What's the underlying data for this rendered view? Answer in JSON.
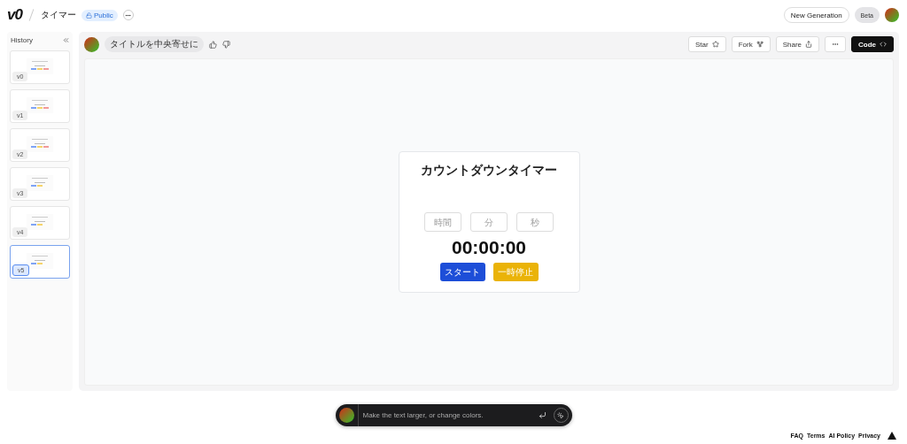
{
  "header": {
    "logo": "v0",
    "project": "タイマー",
    "visibility": "Public",
    "new_generation": "New Generation",
    "beta": "Beta"
  },
  "history": {
    "title": "History",
    "items": [
      {
        "label": "v0",
        "selected": false
      },
      {
        "label": "v1",
        "selected": false
      },
      {
        "label": "v2",
        "selected": false
      },
      {
        "label": "v3",
        "selected": false
      },
      {
        "label": "v4",
        "selected": false
      },
      {
        "label": "v5",
        "selected": true
      }
    ]
  },
  "toolbar": {
    "prompt_chip": "タイトルを中央寄せに",
    "buttons": [
      {
        "label": "Star",
        "kind": "star"
      },
      {
        "label": "Fork",
        "kind": "fork"
      },
      {
        "label": "Share",
        "kind": "share"
      },
      {
        "kind": "more"
      },
      {
        "label": "Code",
        "kind": "code"
      }
    ]
  },
  "preview": {
    "title": "カウントダウンタイマー",
    "fields": [
      {
        "placeholder": "時間"
      },
      {
        "placeholder": "分"
      },
      {
        "placeholder": "秒"
      }
    ],
    "time": "00:00:00",
    "start": "スタート",
    "pause": "一時停止"
  },
  "prompt": {
    "placeholder": "Make the text larger, or change colors."
  },
  "footer": {
    "links": [
      "FAQ",
      "Terms",
      "AI Policy",
      "Privacy"
    ]
  }
}
